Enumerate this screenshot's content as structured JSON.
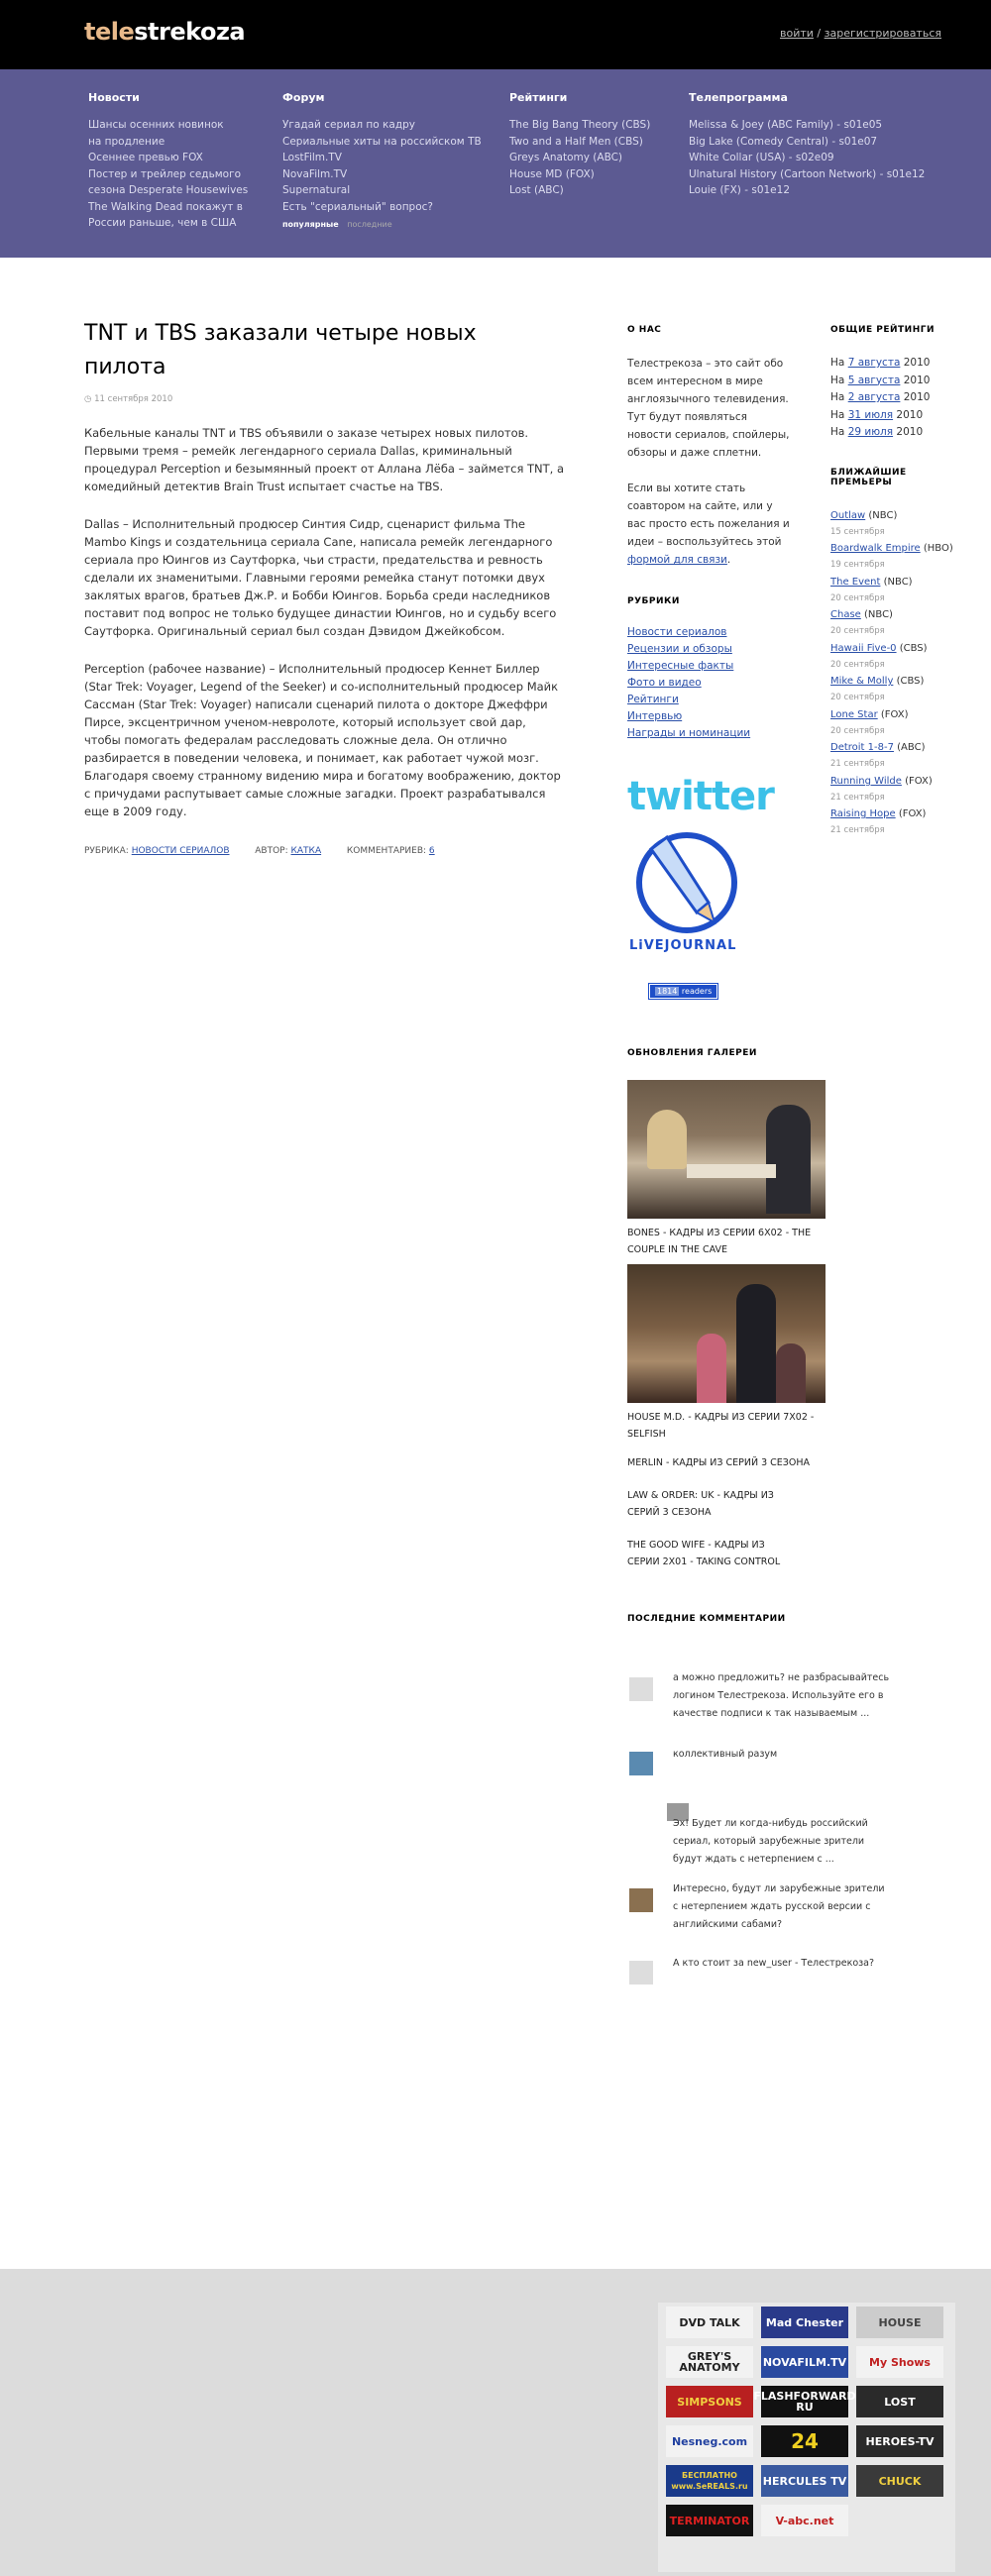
{
  "site": {
    "logo_part1": "tele",
    "logo_part2": "strekoza",
    "login": "войти",
    "separator": "/",
    "register": "зарегистрироваться"
  },
  "nav": {
    "news": {
      "title": "Новости",
      "items": [
        "Шансы осенних новинок",
        "на продление",
        "Осеннее превью FOX",
        "Постер и трейлер седьмого",
        "сезона Desperate Housewives",
        "The Walking Dead покажут в",
        "России раньше, чем в США"
      ]
    },
    "forum": {
      "title": "Форум",
      "items": [
        "Угадай сериал по кадру",
        "Сериальные хиты на российском ТВ",
        "LostFilm.TV",
        "NovaFilm.TV",
        "Supernatural",
        "Есть \"сериальный\" вопрос?"
      ],
      "tab_popular": "популярные",
      "tab_recent": "последние"
    },
    "ratings": {
      "title": "Рейтинги",
      "items": [
        "The Big Bang Theory (CBS)",
        "Two and a Half Men (CBS)",
        "Greys Anatomy (ABC)",
        "House MD (FOX)",
        "Lost (ABC)"
      ]
    },
    "tv": {
      "title": "Телепрограмма",
      "items": [
        "Melissa & Joey (ABC Family) - s01e05",
        "Big Lake (Comedy Central) - s01e07",
        "White Collar (USA) - s02e09",
        "Ulnatural History (Cartoon Network) - s01e12",
        "Louie (FX) - s01e12"
      ]
    }
  },
  "article": {
    "title": "TNT и TBS заказали четыре новых пилота",
    "date": "11 сентября 2010",
    "p1": "Кабельные каналы TNT и TBS объявили о заказе четырех новых пилотов. Первыми тремя – ремейк легендарного сериала Dallas, криминальный процедурал Perception и безымянный проект от Аллана Лёба – займется TNT, а комедийный детектив Brain Trust испытает счастье на TBS.",
    "p2": "Dallas – Исполнительный продюсер Синтия Сидр, сценарист фильма The Mambo Kings и создательница сериала Cane, написала ремейк легендарного сериала про Юингов из Саутфорка, чьи страсти, предательства и ревность сделали их знаменитыми. Главными героями ремейка станут потомки двух заклятых врагов, братьев Дж.Р. и Бобби Юингов. Борьба среди наследников поставит под вопрос не только будущее династии Юингов, но и судьбу всего Саутфорка. Оригинальный сериал был создан Дэвидом Джейкобсом.",
    "p3": "Perception (рабочее название) – Исполнительный продюсер Кеннет Биллер (Star Trek: Voyager, Legend of the Seeker) и со-исполнительный продюсер Майк Сассман (Star Trek: Voyager) написали сценарий пилота о докторе Джеффри Пирсе, эксцентричном ученом-невролоте, который использует свой дар, чтобы помогать федералам расследовать сложные дела. Он отлично разбирается в поведении человека, и понимает, как работает чужой мозг. Благодаря своему странному видению мира и богатому воображению, доктор с причудами распутывает самые сложные загадки. Проект разрабатывался еще в 2009 году.",
    "rubric_label": "РУБРИКА:",
    "rubric_link": "НОВОСТИ СЕРИАЛОВ",
    "author_label": "АВТОР:",
    "author_link": "КАТКА",
    "comments_label": "КОММЕНТАРИЕВ:",
    "comments_count": "6"
  },
  "sidebar": {
    "about_title": "О НАС",
    "about_text": "Телестрекоза – это сайт обо всем интересном в мире англоязычного телевидения. Тут будут появляться новости сериалов, спойлеры, обзоры и даже сплетни.",
    "coauthor_text": "Если вы хотите стать соавтором на сайте, или у вас просто есть пожелания и идеи – воспользуйтесь этой",
    "coauthor_link": "формой для связи",
    "coauthor_end": ".",
    "rubrics_title": "РУБРИКИ",
    "rubrics": [
      "Новости сериалов",
      "Рецензии и обзоры",
      "Интересные факты",
      "Фото и видео",
      "Рейтинги",
      "Интервью",
      "Награды и номинации"
    ],
    "twitter": "twitter",
    "lj_label": "LiVEJOURNAL",
    "readers_count": "1814",
    "readers_label": "readers",
    "gallery_title": "ОБНОВЛЕНИЯ ГАЛЕРЕИ",
    "gallery": [
      "BONES - КАДРЫ ИЗ СЕРИИ 6X02 - THE COUPLE IN THE CAVE",
      "HOUSE M.D. - КАДРЫ ИЗ СЕРИИ 7X02 - SELFISH",
      "MERLIN - КАДРЫ ИЗ СЕРИЙ 3 СЕЗОНА",
      "LAW & ORDER: UK - КАДРЫ ИЗ СЕРИЙ 3 СЕЗОНА",
      "THE GOOD WIFE - КАДРЫ ИЗ СЕРИИ 2X01 - TAKING CONTROL"
    ],
    "comments_title": "ПОСЛЕДНИЕ КОММЕНТАРИИ",
    "comments": [
      "а можно предложить? не разбрасывайтесь логином Телестрекоза. Используйте его в качестве подписи к так называемым ...",
      "коллективный разум",
      "Эх! Будет ли когда-нибудь российский сериал, который зарубежные зрители будут ждать с нетерпением с ...",
      "Интересно, будут ли зарубежные зрители с нетерпением ждать русской версии с английскими сабами?",
      "А кто стоит за new_user - Телестрекоза?"
    ]
  },
  "ratings_col": {
    "title": "ОБЩИЕ РЕЙТИНГИ",
    "prefix": "На",
    "dates": [
      "7 августа",
      "5 августа",
      "2 августа",
      "31 июля",
      "29 июля"
    ],
    "year": "2010"
  },
  "premieres": {
    "title": "БЛИЖАЙШИЕ ПРЕМЬЕРЫ",
    "items": [
      {
        "name": "Outlaw",
        "net": "(NBC)",
        "date": "15 сентября"
      },
      {
        "name": "Boardwalk Empire",
        "net": "(HBO)",
        "date": "19 сентября"
      },
      {
        "name": "The Event",
        "net": "(NBC)",
        "date": "20 сентября"
      },
      {
        "name": "Chase",
        "net": "(NBC)",
        "date": "20 сентября"
      },
      {
        "name": "Hawaii Five-0",
        "net": "(CBS)",
        "date": "20 сентября"
      },
      {
        "name": "Mike & Molly",
        "net": "(CBS)",
        "date": "20 сентября"
      },
      {
        "name": "Lone Star",
        "net": "(FOX)",
        "date": "20 сентября"
      },
      {
        "name": "Detroit 1-8-7",
        "net": "(ABC)",
        "date": "21 сентября"
      },
      {
        "name": "Running Wilde",
        "net": "(FOX)",
        "date": "21 сентября"
      },
      {
        "name": "Raising Hope",
        "net": "(FOX)",
        "date": "21 сентября"
      }
    ]
  },
  "footer_badges": [
    "DVD TALK",
    "Mad Chester",
    "HOUSE",
    "GREY'S ANATOMY",
    "NOVAFILM.TV",
    "My Shows",
    "SIMPSONS",
    "FLASHFORWARD RU",
    "LOST",
    "Nesneg.com",
    "24",
    "HEROES-TV",
    "БЕСПЛАТНО www.SeREALS.ru",
    "HERCULES TV",
    "CHUCK",
    "TERMINATOR",
    "V-abc.net"
  ],
  "colors": {
    "nav_bg": "#5c5a92",
    "top_bg": "#000000",
    "link": "#2a4fa8",
    "footer_bg": "#dcdcdc"
  }
}
